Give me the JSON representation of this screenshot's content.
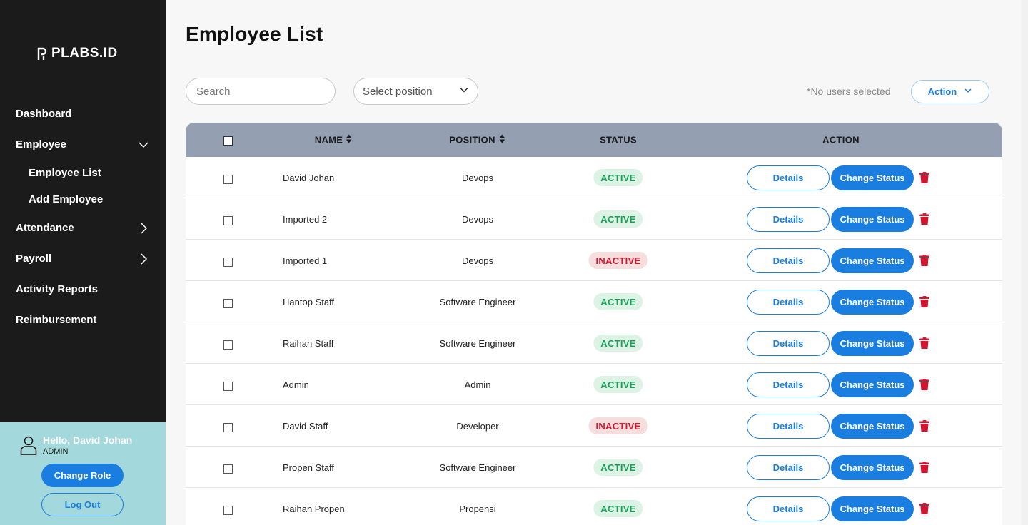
{
  "sidebar": {
    "logo_text": "PLABS.ID",
    "nav": {
      "dashboard": "Dashboard",
      "employee": "Employee",
      "employee_list": "Employee List",
      "add_employee": "Add Employee",
      "attendance": "Attendance",
      "payroll": "Payroll",
      "activity_reports": "Activity Reports",
      "reimbursement": "Reimbursement"
    },
    "user": {
      "greeting": "Hello, David Johan",
      "role": "ADMIN",
      "change_role": "Change Role",
      "logout": "Log Out"
    }
  },
  "main": {
    "title": "Employee List",
    "search_placeholder": "Search",
    "position_select": "Select position",
    "selection_status": "*No users selected",
    "action_label": "Action"
  },
  "table": {
    "headers": {
      "name": "NAME",
      "position": "POSITION",
      "status": "STATUS",
      "action": "ACTION"
    },
    "details_label": "Details",
    "change_status_label": "Change Status",
    "rows": [
      {
        "name": "David Johan",
        "position": "Devops",
        "status": "ACTIVE"
      },
      {
        "name": "Imported 2",
        "position": "Devops",
        "status": "ACTIVE"
      },
      {
        "name": "Imported 1",
        "position": "Devops",
        "status": "INACTIVE"
      },
      {
        "name": "Hantop Staff",
        "position": "Software Engineer",
        "status": "ACTIVE"
      },
      {
        "name": "Raihan Staff",
        "position": "Software Engineer",
        "status": "ACTIVE"
      },
      {
        "name": "Admin",
        "position": "Admin",
        "status": "ACTIVE"
      },
      {
        "name": "David Staff",
        "position": "Developer",
        "status": "INACTIVE"
      },
      {
        "name": "Propen Staff",
        "position": "Software Engineer",
        "status": "ACTIVE"
      },
      {
        "name": "Raihan Propen",
        "position": "Propensi",
        "status": "ACTIVE"
      }
    ]
  },
  "colors": {
    "sidebar_bg": "#1b1b1b",
    "user_panel_bg": "#a3d9dc",
    "primary": "#1a7ee0",
    "table_header_bg": "#959fb2",
    "active": "#1aa158",
    "inactive": "#d1172f"
  }
}
